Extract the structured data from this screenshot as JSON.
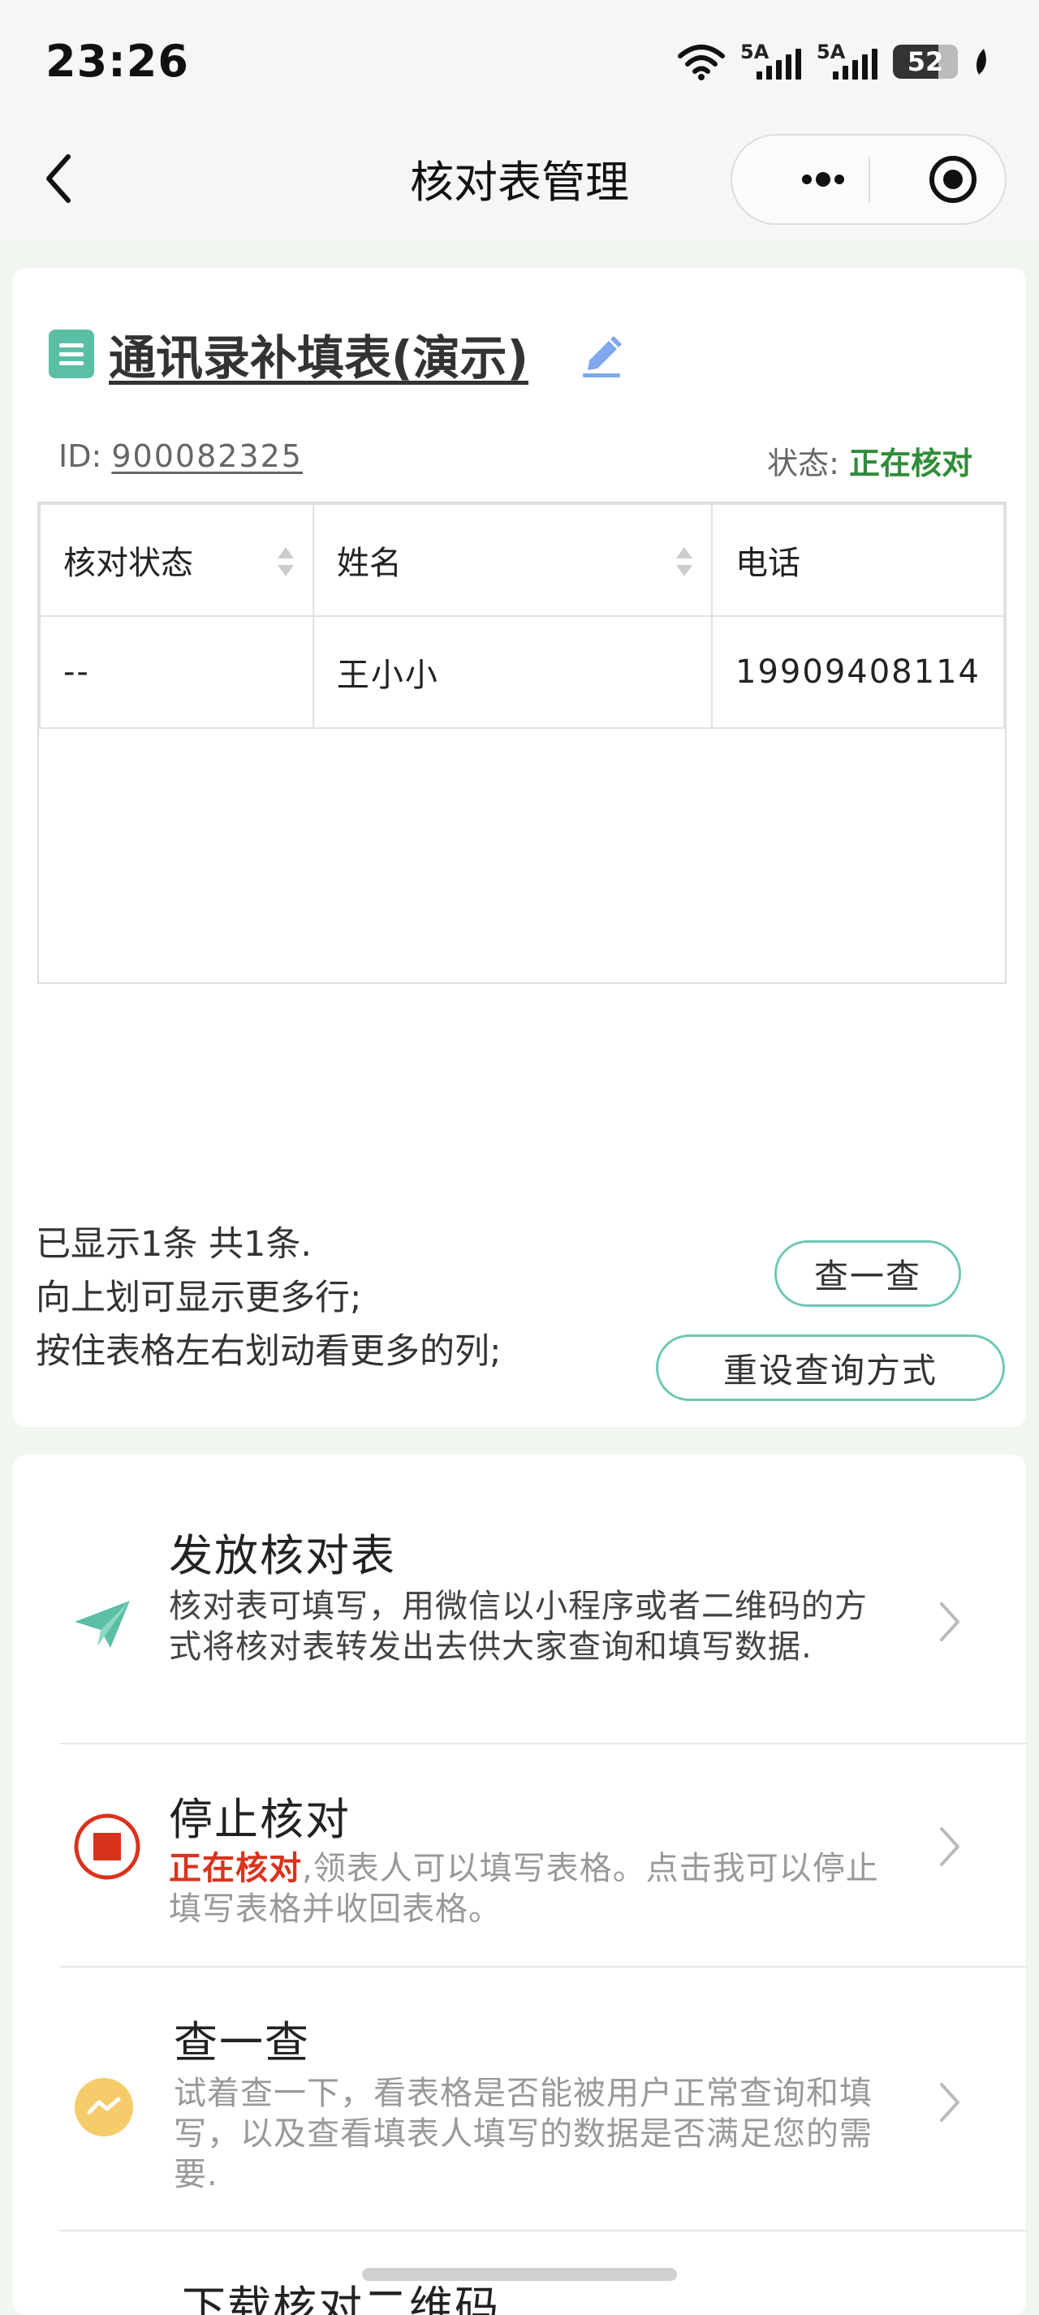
{
  "status_bar": {
    "time": "23:26",
    "network_1": "5A",
    "network_2": "5A",
    "battery": "52"
  },
  "nav": {
    "title": "核对表管理"
  },
  "sheet": {
    "title": "通讯录补填表(演示)",
    "id_label": "ID:",
    "id_value": "900082325",
    "status_label": "状态:",
    "status_value": "正在核对"
  },
  "table": {
    "columns": [
      "核对状态",
      "姓名",
      "电话"
    ],
    "rows": [
      [
        "--",
        "王小小",
        "19909408114"
      ]
    ]
  },
  "summary": {
    "line1": "已显示1条 共1条.",
    "line2": "向上划可显示更多行;",
    "line3": "按住表格左右划动看更多的列;"
  },
  "buttons": {
    "check": "查一查",
    "reset": "重设查询方式"
  },
  "actions": {
    "distribute": {
      "title": "发放核对表",
      "desc": "核对表可填写，用微信以小程序或者二维码的方式将核对表转发出去供大家查询和填写数据."
    },
    "stop": {
      "title": "停止核对",
      "desc_prefix": "正在核对",
      "desc": ",领表人可以填写表格。点击我可以停止填写表格并收回表格。"
    },
    "check": {
      "title": "查一查",
      "desc": "试着查一下，看表格是否能被用户正常查询和填写，以及查看填表人填写的数据是否满足您的需要."
    },
    "download": {
      "title": "下载核对二维码"
    }
  },
  "colors": {
    "accent": "#5bbfa6",
    "status_green": "#2f8c3a",
    "stop_red": "#d9331e",
    "check_yellow": "#f6cc6a"
  }
}
